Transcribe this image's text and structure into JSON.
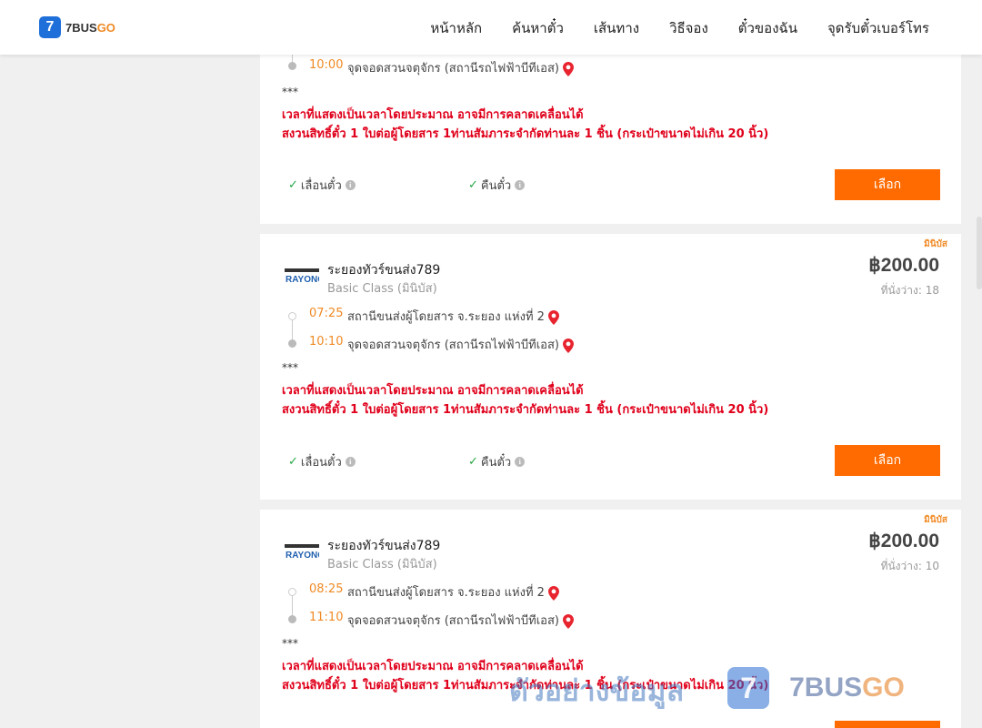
{
  "header": {
    "logo_badge": "7",
    "logo_main": "7BUS",
    "logo_go": "GO",
    "nav": [
      "หน้าหลัก",
      "ค้นหาตั๋ว",
      "เส้นทาง",
      "วิธีจอง",
      "ตั๋วของฉัน",
      "จุดรับตั๋วเบอร์โทร"
    ]
  },
  "common": {
    "stars": "***",
    "note_line1": "เวลาที่แสดงเป็นเวลาโดยประมาณ อาจมีการคลาดเคลื่อนได้",
    "note_line2": "สงวนสิทธิ์ตั๋ว 1 ใบต่อผู้โดยสาร 1ท่านสัมภาระจำกัดท่านละ 1 ชิ้น (กระเป๋าขนาดไม่เกิน 20 นิ้ว)",
    "reschedule": "เลื่อนตั๋ว",
    "refund": "คืนตั๋ว",
    "select": "เลือก",
    "bus_tag": "มินิบัส",
    "check": "✓",
    "info": "i"
  },
  "card0": {
    "arrive_time": "10:00",
    "arrive_place": "จุดจอดสวนจตุจักร (สถานีรถไฟฟ้าบีทีเอส)"
  },
  "card1": {
    "operator": "ระยองทัวร์ขนส่ง789",
    "bus_class": "Basic Class (มินิบัส)",
    "price": "฿200.00",
    "seats": "ที่นั่งว่าง: 18",
    "depart_time": "07:25",
    "depart_place": "สถานีขนส่งผู้โดยสาร จ.ระยอง แห่งที่ 2",
    "arrive_time": "10:10",
    "arrive_place": "จุดจอดสวนจตุจักร (สถานีรถไฟฟ้าบีทีเอส)"
  },
  "card2": {
    "operator": "ระยองทัวร์ขนส่ง789",
    "bus_class": "Basic Class (มินิบัส)",
    "price": "฿200.00",
    "seats": "ที่นั่งว่าง: 10",
    "depart_time": "08:25",
    "depart_place": "สถานีขนส่งผู้โดยสาร จ.ระยอง แห่งที่ 2",
    "arrive_time": "11:10",
    "arrive_place": "จุดจอดสวนจตุจักร (สถานีรถไฟฟ้าบีทีเอส)"
  },
  "watermark": {
    "text": "ตัวอย่างข้อมูล",
    "badge": "7",
    "brand_main": "7BUS",
    "brand_go": "GO"
  },
  "colors": {
    "accent": "#ff6b00",
    "time": "#f08a24",
    "warning": "#e0001b",
    "check": "#28a745"
  }
}
